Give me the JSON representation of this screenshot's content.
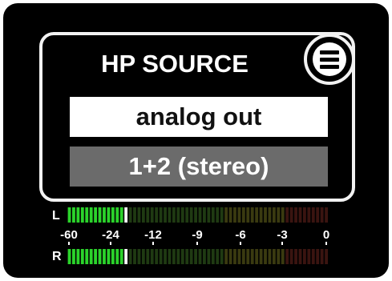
{
  "panel": {
    "title": "HP SOURCE",
    "menu_icon": "hamburger-menu-icon",
    "options": [
      {
        "label": "analog out",
        "state": "selected"
      },
      {
        "label": "1+2 (stereo)",
        "state": "available"
      }
    ]
  },
  "meters": {
    "channels": [
      {
        "label": "L",
        "active_segments": 13,
        "peak_segment": 14
      },
      {
        "label": "R",
        "active_segments": 13,
        "peak_segment": 14
      }
    ],
    "total_segments": 60,
    "scale": [
      "-60",
      "-24",
      "-12",
      "-9",
      "-6",
      "-3",
      "0"
    ]
  },
  "colors": {
    "active": "#2bd32b",
    "peak": "#ffffff",
    "inactive_low": "#1f3a12",
    "inactive_mid": "#3a3a10",
    "inactive_high": "#3a1410",
    "panel_border": "#f2f2f2",
    "selected_bg": "#ffffff",
    "alt_bg": "#6b6b6b"
  }
}
